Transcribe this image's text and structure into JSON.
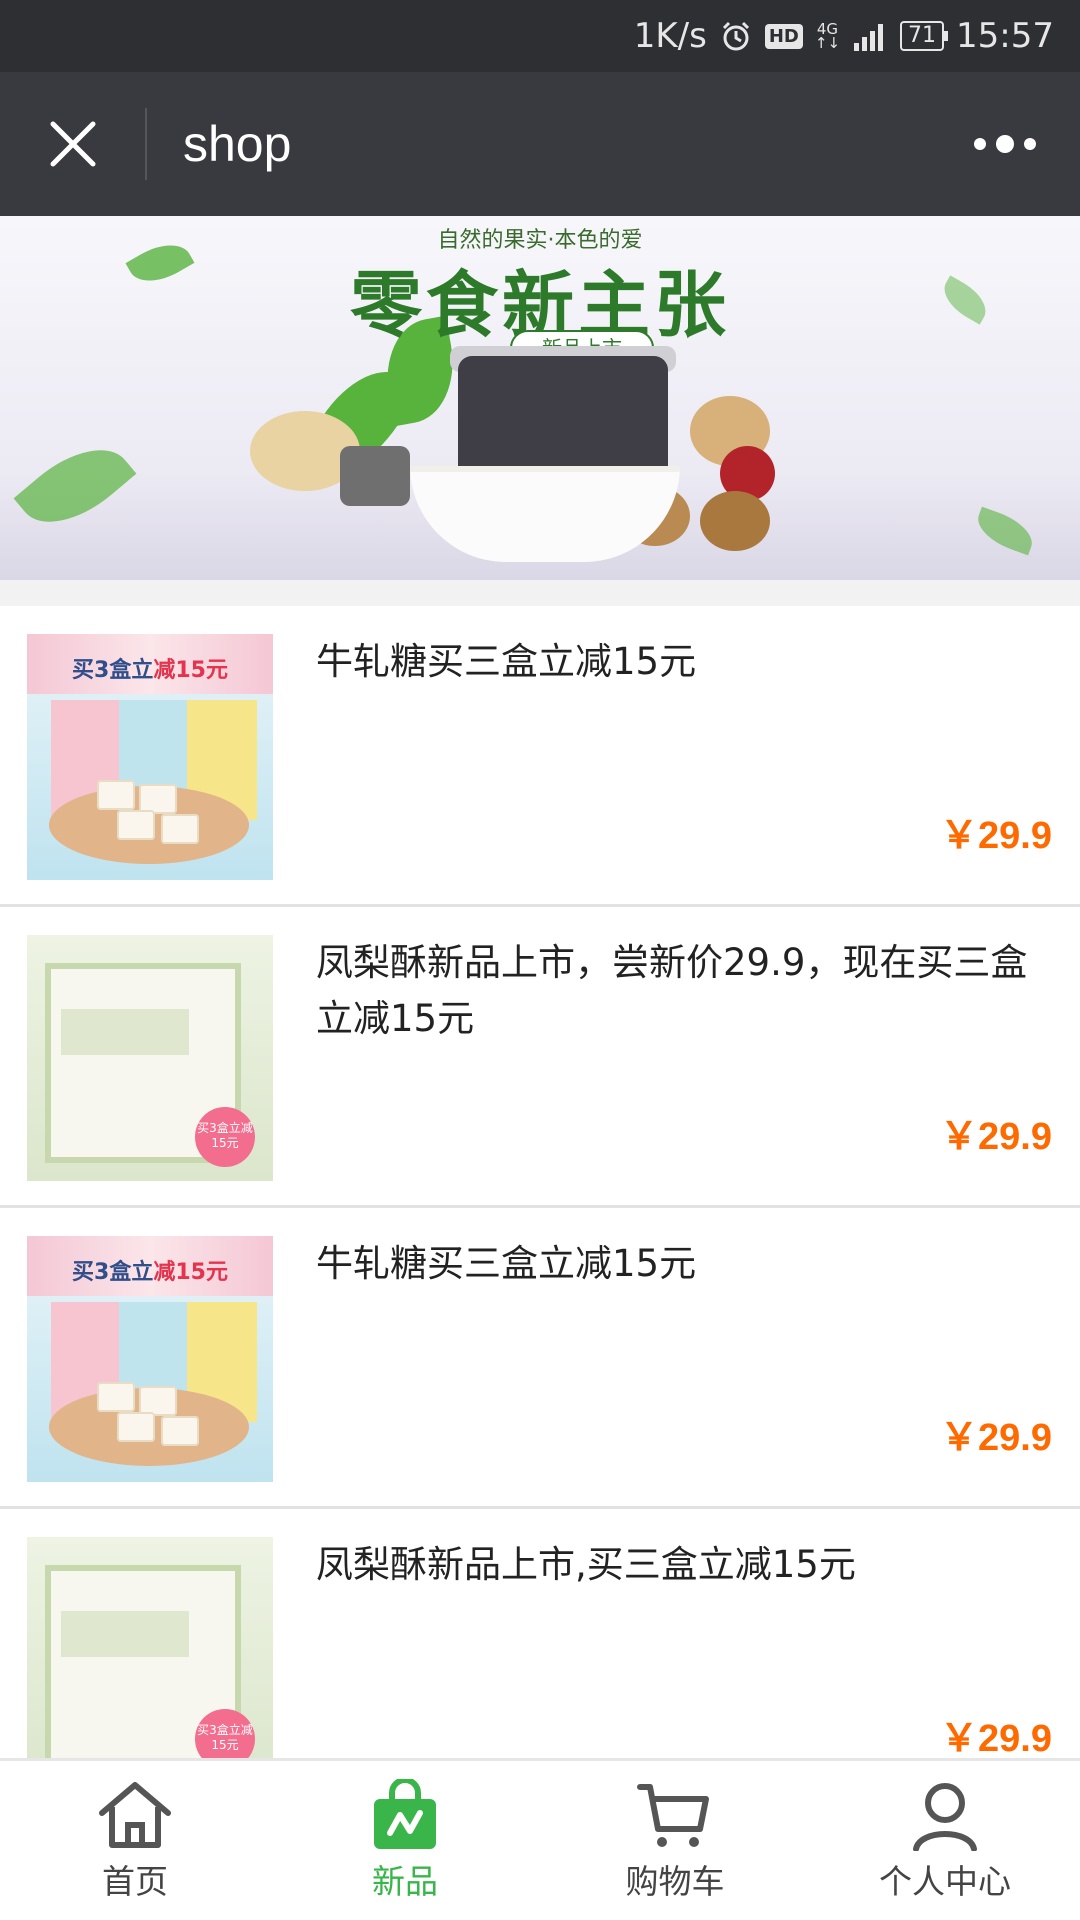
{
  "status_bar": {
    "net_speed": "1K/s",
    "hd": "HD",
    "network": "4G",
    "battery": "71",
    "time": "15:57"
  },
  "navbar": {
    "title": "shop",
    "close_icon": "close-icon",
    "more_icon": "more-icon"
  },
  "banner": {
    "subtitle": "自然的果实·本色的爱",
    "title": "零食新主张",
    "tag": "新品上市"
  },
  "products": [
    {
      "name": "牛轧糖买三盒立减15元",
      "price": "￥29.9",
      "image": "nougat",
      "image_text": "买3盒立",
      "image_text_accent": "减15元"
    },
    {
      "name": "凤梨酥新品上市，尝新价29.9，现在买三盒立减15元",
      "price": "￥29.9",
      "image": "pineapple-cake",
      "badge": "买3盒立减15元"
    },
    {
      "name": "牛轧糖买三盒立减15元",
      "price": "￥29.9",
      "image": "nougat",
      "image_text": "买3盒立",
      "image_text_accent": "减15元"
    },
    {
      "name": "凤梨酥新品上市,买三盒立减15元",
      "price": "￥29.9",
      "image": "pineapple-cake",
      "badge": "买3盒立减15元"
    }
  ],
  "tabbar": {
    "items": [
      {
        "label": "首页",
        "icon": "home-icon",
        "active": false
      },
      {
        "label": "新品",
        "icon": "new-bag-icon",
        "active": true
      },
      {
        "label": "购物车",
        "icon": "cart-icon",
        "active": false
      },
      {
        "label": "个人中心",
        "icon": "user-icon",
        "active": false
      }
    ],
    "active_color": "#39b54a",
    "inactive_color": "#555555"
  },
  "colors": {
    "price": "#ff6a00",
    "navbar": "#393a3f",
    "status_bar": "#2e2f33"
  }
}
